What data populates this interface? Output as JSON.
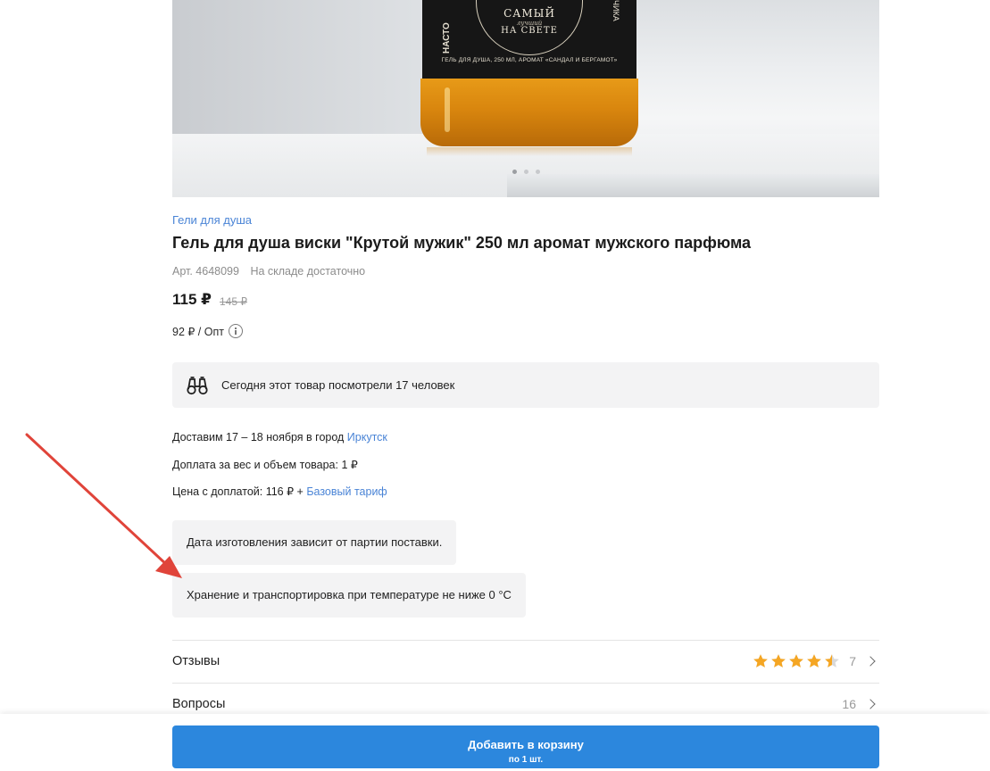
{
  "product": {
    "image_label": {
      "line1": "САМЫЙ",
      "line2": "лучший",
      "line3": "НА СВЕТЕ",
      "side_left": "НАСТО",
      "side_right": "ЧИКА",
      "caption": "ГЕЛЬ ДЛЯ ДУША, 250 МЛ, АРОМАТ «САНДАЛ И БЕРГАМОТ»"
    },
    "gallery_count": 3,
    "gallery_active_index": 0,
    "category": "Гели для душа",
    "title": "Гель для душа виски \"Крутой мужик\" 250 мл аромат мужского парфюма",
    "article": "Арт. 4648099",
    "stock": "На складе достаточно",
    "price": "115 ₽",
    "old_price": "145 ₽",
    "wholesale": "92 ₽ / Опт"
  },
  "views_banner": {
    "icon": "binoculars-icon",
    "text": "Сегодня этот товар посмотрели 17 человек"
  },
  "delivery": {
    "line1_text": "Доставим 17 – 18 ноября в город ",
    "line1_city": "Иркутск",
    "line2": "Доплата за вес и объем товара: 1 ₽",
    "line3_text": "Цена с доплатой: 116 ₽ + ",
    "line3_link": "Базовый тариф"
  },
  "notes": {
    "manufacture": "Дата изготовления зависит от партии поставки.",
    "storage": "Хранение и транспортировка при температуре не ниже 0 °C"
  },
  "reviews": {
    "label": "Отзывы",
    "rating": 4.5,
    "count": "7"
  },
  "questions": {
    "label": "Вопросы",
    "count": "16"
  },
  "cart_button": {
    "label": "Добавить в корзину",
    "sublabel": "по 1 шт."
  },
  "colors": {
    "accent": "#2c87dd",
    "link": "#4a84d6",
    "star": "#f5a623",
    "annotation_arrow": "#e0443a"
  }
}
